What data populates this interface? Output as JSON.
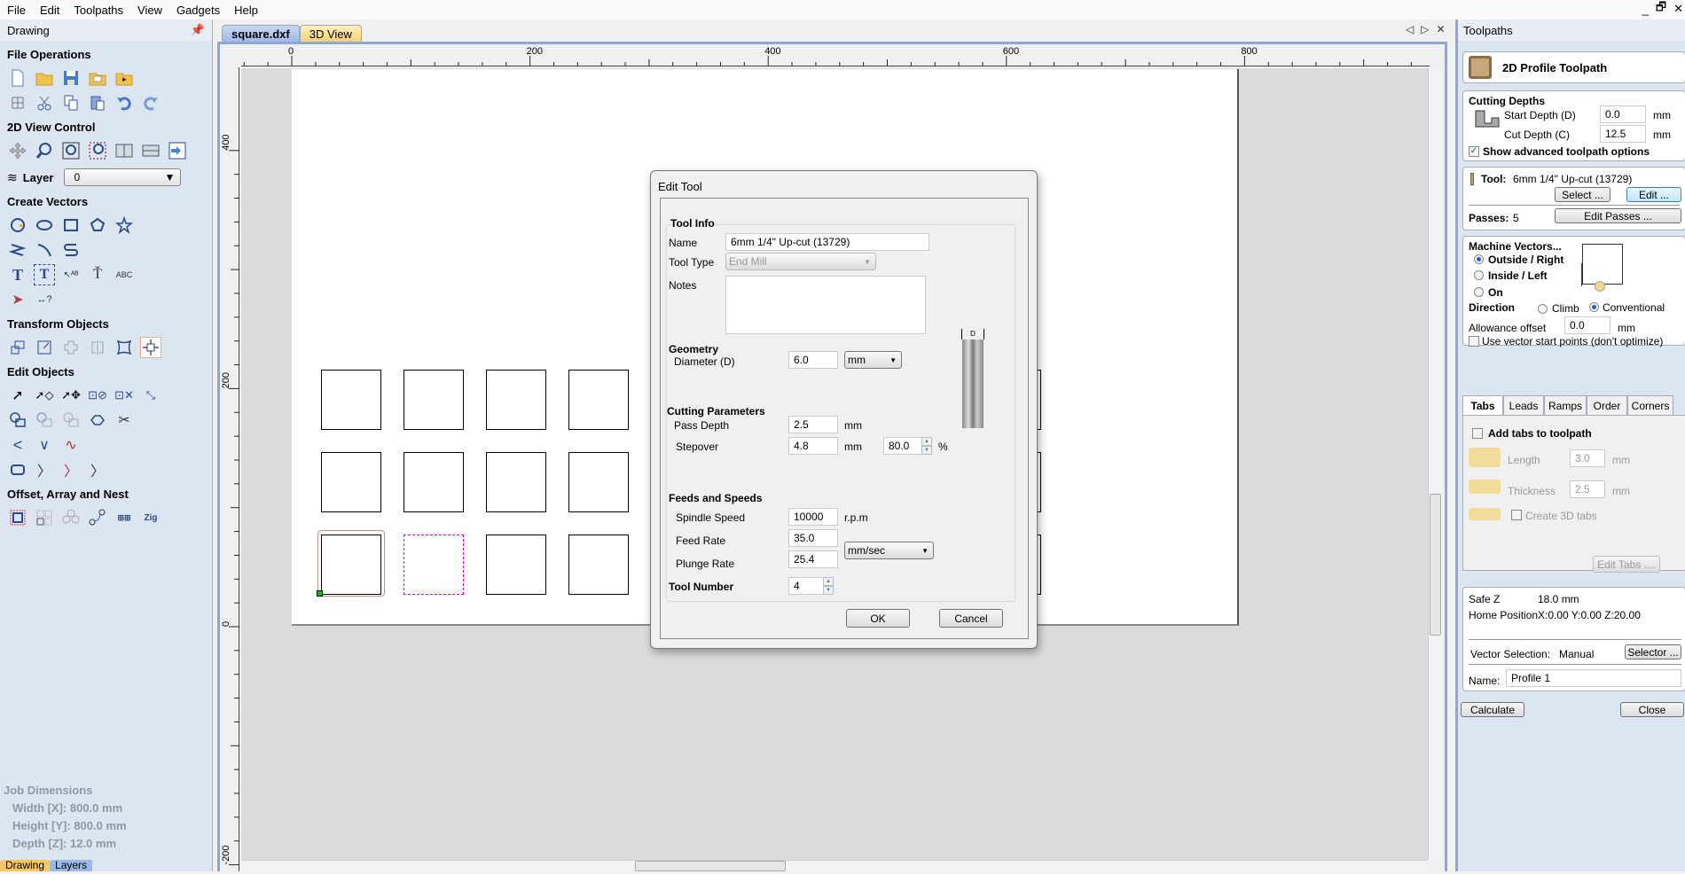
{
  "menu": {
    "items": [
      "File",
      "Edit",
      "Toolpaths",
      "View",
      "Gadgets",
      "Help"
    ]
  },
  "window_controls": {
    "minimize": "_",
    "restore": "🗗",
    "close": "✕"
  },
  "left_panel": {
    "title": "Drawing",
    "pin_icon": "pin-icon",
    "sections": {
      "file_operations": "File Operations",
      "view_control": "2D View Control",
      "create_vectors": "Create Vectors",
      "transform_objects": "Transform Objects",
      "edit_objects": "Edit Objects",
      "offset_array_nest": "Offset, Array and Nest"
    },
    "layer": {
      "label": "Layer",
      "value": "0"
    },
    "job_dimensions": {
      "title": "Job Dimensions",
      "width": "Width  [X]: 800.0 mm",
      "height": "Height [Y]: 800.0 mm",
      "depth": "Depth  [Z]: 12.0 mm"
    },
    "bottom_tabs": [
      "Drawing",
      "Layers"
    ]
  },
  "document": {
    "tabs": [
      "square.dxf",
      "3D View"
    ],
    "active_tab": "square.dxf",
    "ruler_h_labels": [
      "0",
      "200",
      "400",
      "600",
      "800"
    ],
    "ruler_v_labels": [
      "400",
      "200",
      "0",
      "-200"
    ]
  },
  "dialog": {
    "title": "Edit Tool",
    "tool_info_heading": "Tool Info",
    "name_label": "Name",
    "name_value": "6mm 1/4\" Up-cut (13729)",
    "tool_type_label": "Tool Type",
    "tool_type_value": "End Mill",
    "notes_label": "Notes",
    "notes_value": "",
    "geometry_heading": "Geometry",
    "diameter_label": "Diameter (D)",
    "diameter_value": "6.0",
    "diameter_unit": "mm",
    "cutting_heading": "Cutting Parameters",
    "pass_depth_label": "Pass Depth",
    "pass_depth_value": "2.5",
    "pass_depth_unit": "mm",
    "stepover_label": "Stepover",
    "stepover_value": "4.8",
    "stepover_unit": "mm",
    "stepover_pct": "80.0",
    "pct_sign": "%",
    "feeds_heading": "Feeds and Speeds",
    "spindle_label": "Spindle Speed",
    "spindle_value": "10000",
    "spindle_unit": "r.p.m",
    "feed_label": "Feed Rate",
    "feed_value": "35.0",
    "plunge_label": "Plunge Rate",
    "plunge_value": "25.4",
    "rate_unit": "mm/sec",
    "tool_number_label": "Tool Number",
    "tool_number_value": "4",
    "ok": "OK",
    "cancel": "Cancel",
    "diagram_label": "D"
  },
  "toolpaths_panel": {
    "title": "Toolpaths",
    "header": "2D Profile Toolpath",
    "cutting_depths": "Cutting Depths",
    "start_depth_label": "Start Depth (D)",
    "start_depth_value": "0.0",
    "cut_depth_label": "Cut Depth (C)",
    "cut_depth_value": "12.5",
    "unit": "mm",
    "advanced_label": "Show advanced toolpath options",
    "advanced_checked": true,
    "tool_label": "Tool:",
    "tool_value": "6mm 1/4\" Up-cut (13729)",
    "select_btn": "Select ...",
    "edit_btn": "Edit ...",
    "passes_label": "Passes:",
    "passes_value": "5",
    "edit_passes_btn": "Edit Passes ...",
    "machine_vectors": "Machine Vectors...",
    "outside": "Outside / Right",
    "inside": "Inside / Left",
    "on": "On",
    "selected_side": "Outside / Right",
    "direction_label": "Direction",
    "climb": "Climb",
    "conventional": "Conventional",
    "selected_direction": "Conventional",
    "allowance_label": "Allowance offset",
    "allowance_value": "0.0",
    "start_points_label": "Use vector start points (don't optimize)",
    "tabs": [
      "Tabs",
      "Leads",
      "Ramps",
      "Order",
      "Corners"
    ],
    "active_tab": "Tabs",
    "add_tabs_label": "Add tabs to toolpath",
    "length_label": "Length",
    "length_value": "3.0",
    "thickness_label": "Thickness",
    "thickness_value": "2.5",
    "create_3d_label": "Create 3D tabs",
    "edit_tabs_btn": "Edit Tabs ....",
    "safe_z_label": "Safe Z",
    "safe_z_value": "18.0 mm",
    "home_label": "Home Position",
    "home_value": "X:0.00 Y:0.00 Z:20.00",
    "vector_selection_label": "Vector Selection:",
    "vector_selection_value": "Manual",
    "selector_btn": "Selector ...",
    "name_label": "Name:",
    "name_value": "Profile 1",
    "calculate_btn": "Calculate",
    "close_btn": "Close"
  },
  "colors": {
    "accent": "#8fa6d8",
    "panel_bg": "#dce6f1",
    "selection_dash": "#e000e0",
    "toolpath": "#c08a8a",
    "start_point": "#22aa22"
  }
}
